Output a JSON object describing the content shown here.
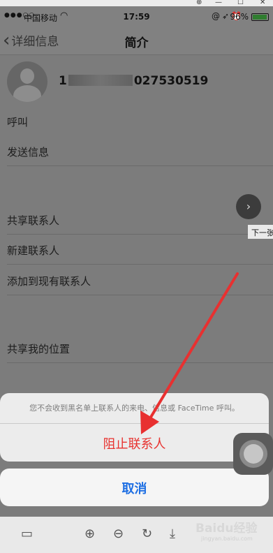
{
  "status_bar": {
    "carrier": "中国移动",
    "time": "17:59",
    "battery": "96%"
  },
  "nav": {
    "back_label": "详细信息",
    "title": "简介"
  },
  "contact": {
    "phone_prefix": "1",
    "phone_suffix": "027530519"
  },
  "rows": {
    "call": "呼叫",
    "message": "发送信息",
    "share_contact": "共享联系人",
    "new_contact": "新建联系人",
    "add_existing": "添加到现有联系人",
    "share_location": "共享我的位置"
  },
  "viewer": {
    "next_label": "下一张"
  },
  "action_sheet": {
    "message": "您不会收到黑名单上联系人的来电、信息或 FaceTime 呼叫。",
    "block_label": "阻止联系人",
    "cancel_label": "取消"
  },
  "watermark": {
    "brand": "Baidu经验",
    "url": "jingyan.baidu.com"
  },
  "colors": {
    "destructive": "#e8322f",
    "action": "#1e6fe3",
    "annotation_arrow": "#e83030"
  }
}
